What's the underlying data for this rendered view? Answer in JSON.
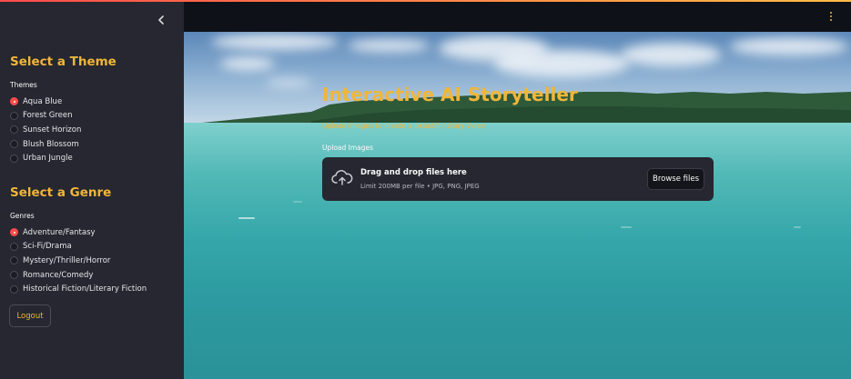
{
  "sidebar": {
    "collapse_icon": "chevron-left-icon",
    "theme_section": {
      "title": "Select a Theme",
      "group_label": "Themes",
      "options": [
        "Aqua Blue",
        "Forest Green",
        "Sunset Horizon",
        "Blush Blossom",
        "Urban Jungle"
      ],
      "selected": "Aqua Blue"
    },
    "genre_section": {
      "title": "Select a Genre",
      "group_label": "Genres",
      "options": [
        "Adventure/Fantasy",
        "Sci-Fi/Drama",
        "Mystery/Thriller/Horror",
        "Romance/Comedy",
        "Historical Fiction/Literary Fiction"
      ],
      "selected": "Adventure/Fantasy"
    },
    "logout_label": "Logout"
  },
  "header": {
    "menu_icon": "kebab-menu-icon"
  },
  "main": {
    "title": "Interactive AI Storyteller",
    "subtitle": "Upload images to create a beautiful story video",
    "uploader": {
      "label": "Upload Images",
      "drop_text": "Drag and drop files here",
      "limit_text": "Limit 200MB per file • JPG, PNG, JPEG",
      "browse_label": "Browse files",
      "icon": "cloud-upload-icon"
    }
  },
  "colors": {
    "accent": "#f0b63a",
    "radio_selected": "#ff4b4b",
    "sidebar_bg": "#262730",
    "header_bg": "#0e1117"
  }
}
